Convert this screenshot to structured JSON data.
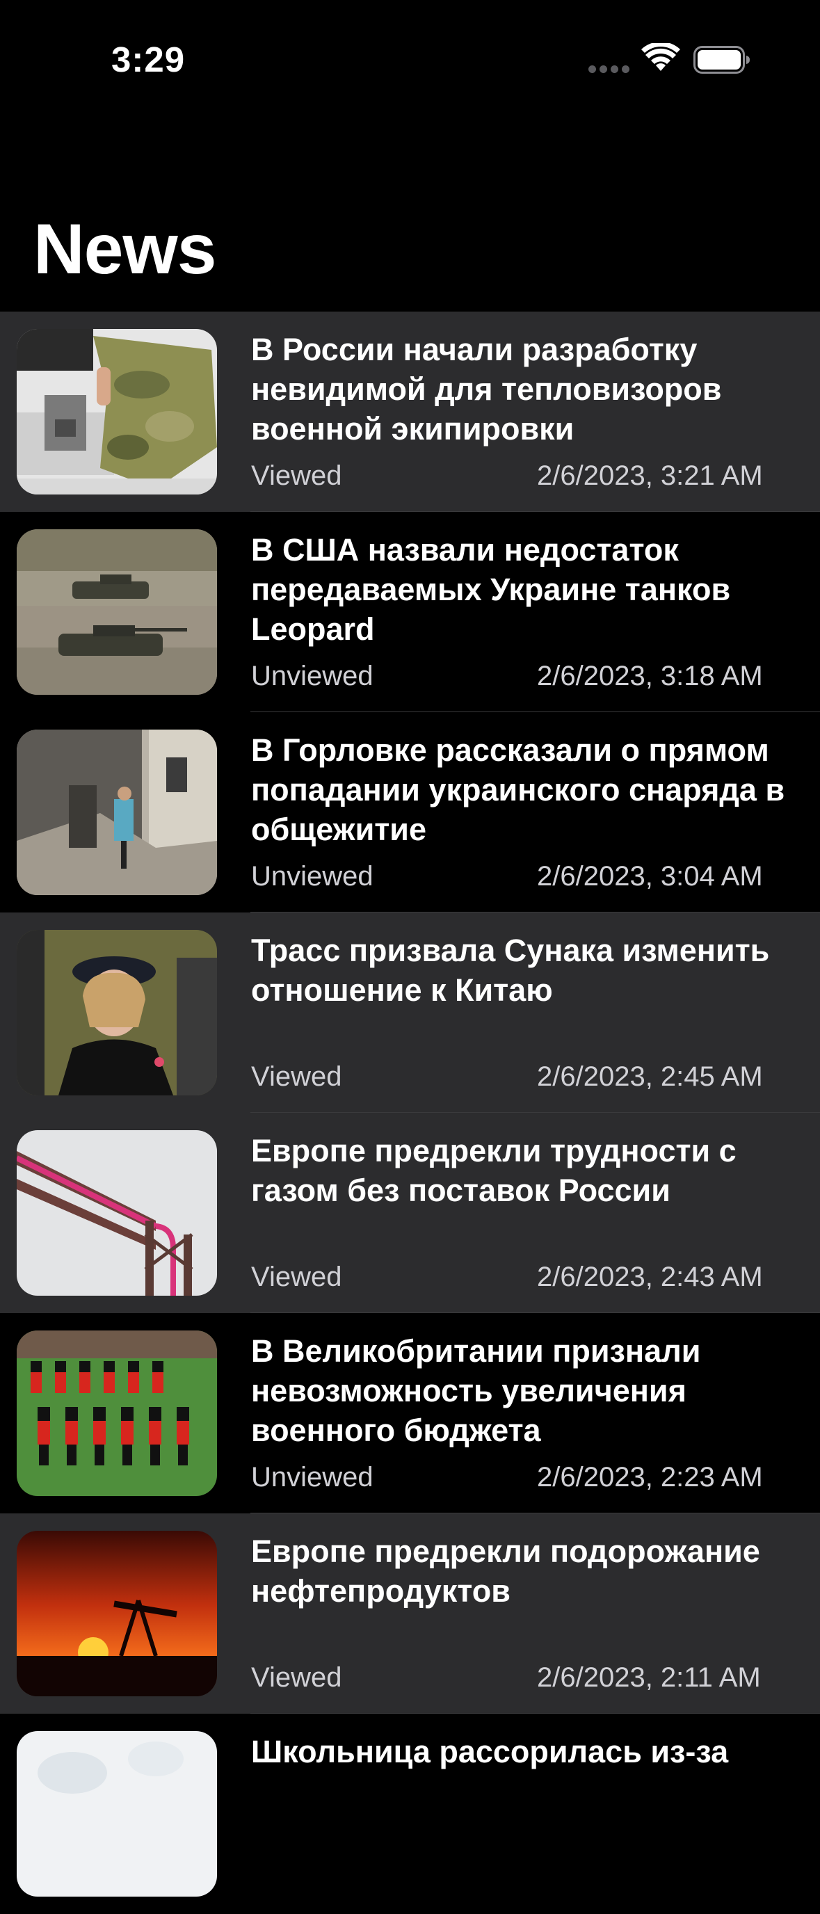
{
  "status_bar": {
    "time": "3:29",
    "signal_icon": "signal-dots-icon",
    "wifi_icon": "wifi-icon",
    "battery_icon": "battery-icon",
    "battery_level": 1.0
  },
  "header": {
    "title": "News"
  },
  "colors": {
    "viewed_bg": "#2c2c2e",
    "unviewed_bg": "#000000",
    "text": "#ffffff",
    "meta_text": "#d1d1d6"
  },
  "news": [
    {
      "title": "В России начали разработку невидимой для тепловизоров военной экипировки",
      "status": "Viewed",
      "date": "2/6/2023, 3:21 AM",
      "image": "camouflage-fabric-photo"
    },
    {
      "title": "В США назвали недостаток передаваемых Украине танков Leopard",
      "status": "Unviewed",
      "date": "2/6/2023, 3:18 AM",
      "image": "tanks-photo"
    },
    {
      "title": "В Горловке рассказали о прямом попадании украинского снаряда в общежитие",
      "status": "Unviewed",
      "date": "2/6/2023, 3:04 AM",
      "image": "destroyed-building-photo"
    },
    {
      "title": "Трасс призвала Сунака изменить отношение к Китаю",
      "status": "Viewed",
      "date": "2/6/2023, 2:45 AM",
      "image": "woman-portrait-photo"
    },
    {
      "title": "Европе предрекли трудности с газом без поставок России",
      "status": "Viewed",
      "date": "2/6/2023, 2:43 AM",
      "image": "gas-pipeline-photo"
    },
    {
      "title": "В Великобритании признали невозможность увеличения военного бюджета",
      "status": "Unviewed",
      "date": "2/6/2023, 2:23 AM",
      "image": "guards-parade-photo"
    },
    {
      "title": "Европе предрекли подорожание нефтепродуктов",
      "status": "Viewed",
      "date": "2/6/2023, 2:11 AM",
      "image": "oil-pump-sunset-photo"
    },
    {
      "title": "Школьница рассорилась из-за",
      "status": "",
      "date": "",
      "image": "medical-photo"
    }
  ]
}
